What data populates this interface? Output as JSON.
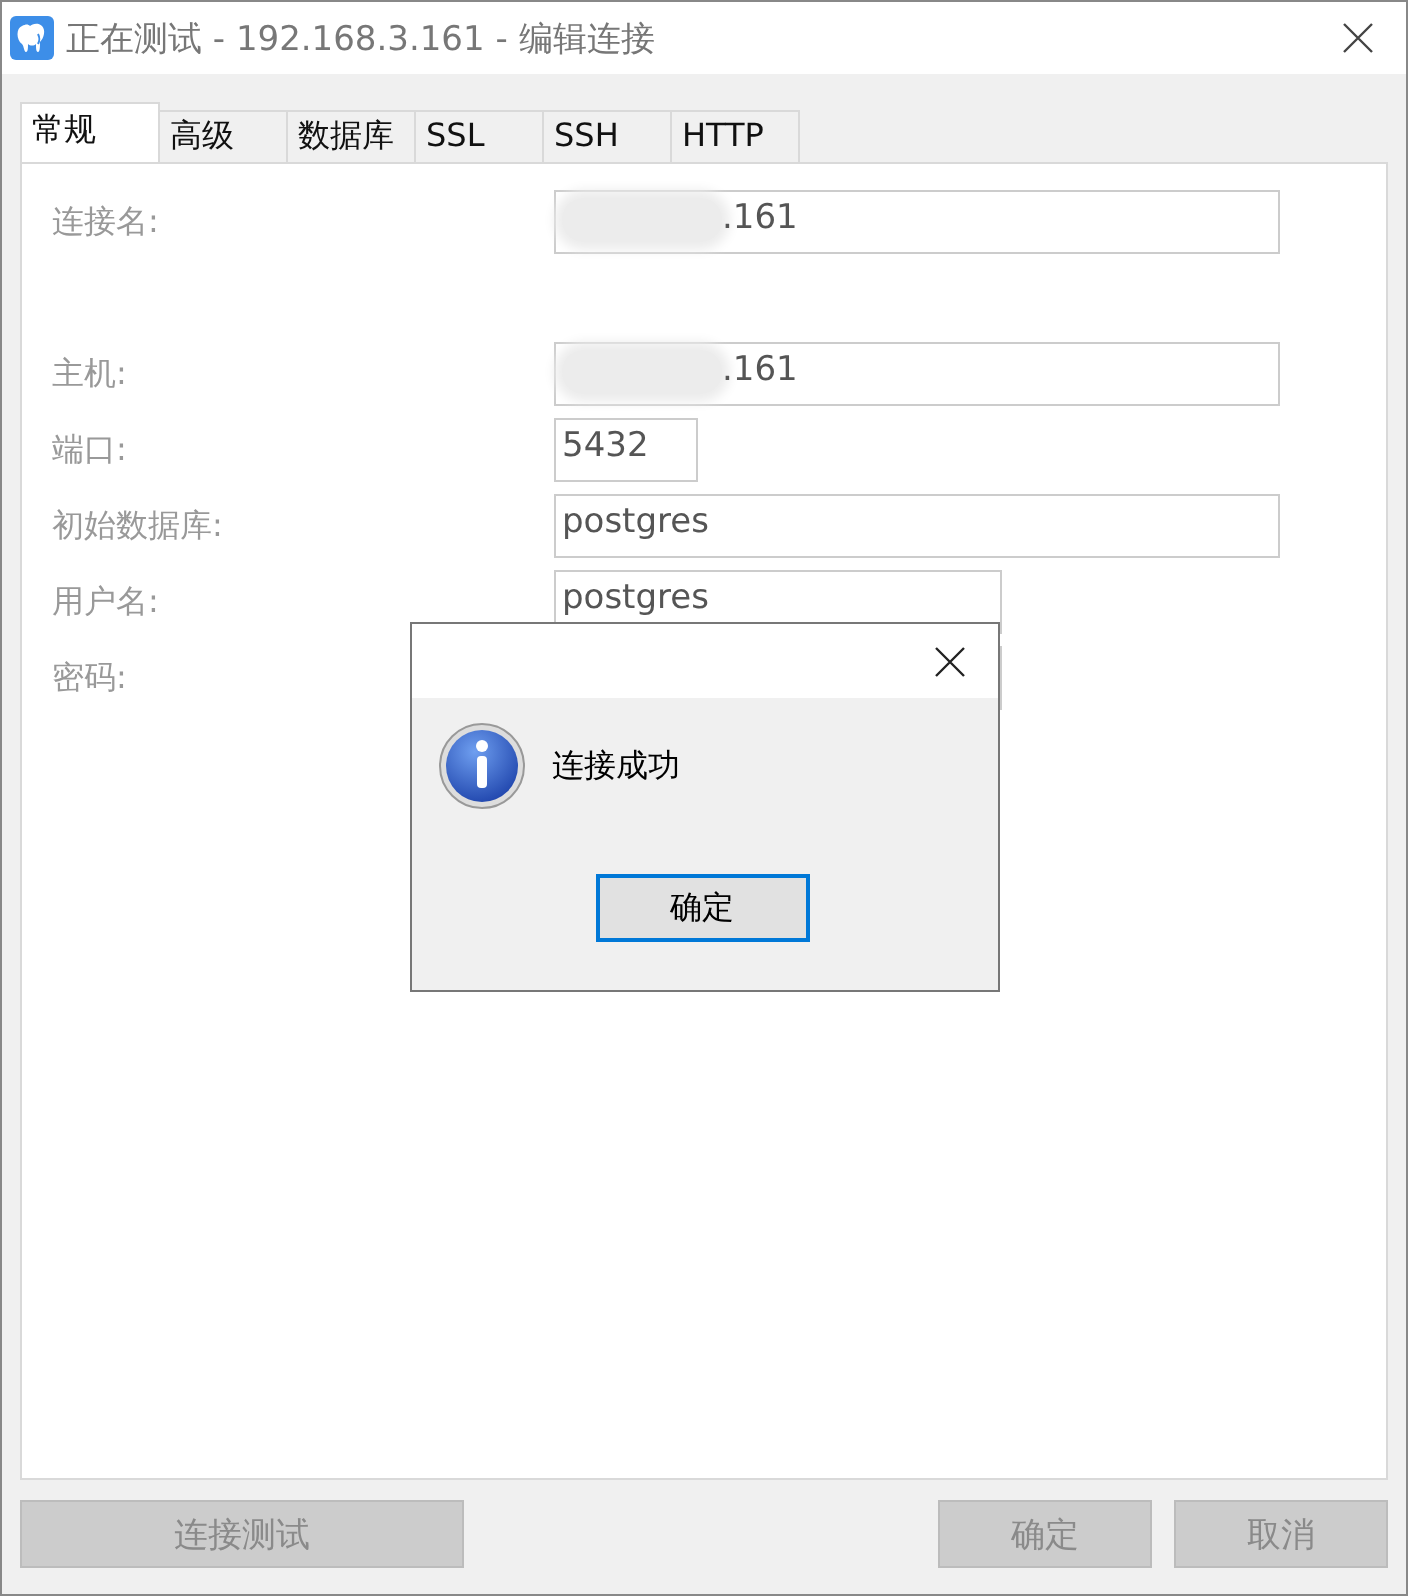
{
  "window": {
    "title": "正在测试 - 192.168.3.161 - 编辑连接"
  },
  "tabs": [
    {
      "label": "常规",
      "selected": true
    },
    {
      "label": "高级",
      "selected": false
    },
    {
      "label": "数据库",
      "selected": false
    },
    {
      "label": "SSL",
      "selected": false
    },
    {
      "label": "SSH",
      "selected": false
    },
    {
      "label": "HTTP",
      "selected": false
    }
  ],
  "fields": [
    {
      "label": "连接名:",
      "value": ".161",
      "redacted": true
    },
    {
      "label": "主机:",
      "value": ".161",
      "redacted": true
    },
    {
      "label": "端口:",
      "value": "5432",
      "redacted": false
    },
    {
      "label": "初始数据库:",
      "value": "postgres",
      "redacted": false
    },
    {
      "label": "用户名:",
      "value": "postgres",
      "redacted": false
    },
    {
      "label": "密码:",
      "redacted": false
    }
  ],
  "buttons": [
    {
      "label": "连接测试",
      "disabled": true
    },
    {
      "label": "确定",
      "disabled": true
    },
    {
      "label": "取消",
      "disabled": true
    }
  ],
  "dialog": {
    "message": "连接成功",
    "button": {
      "label": "确定",
      "focused": true
    }
  }
}
